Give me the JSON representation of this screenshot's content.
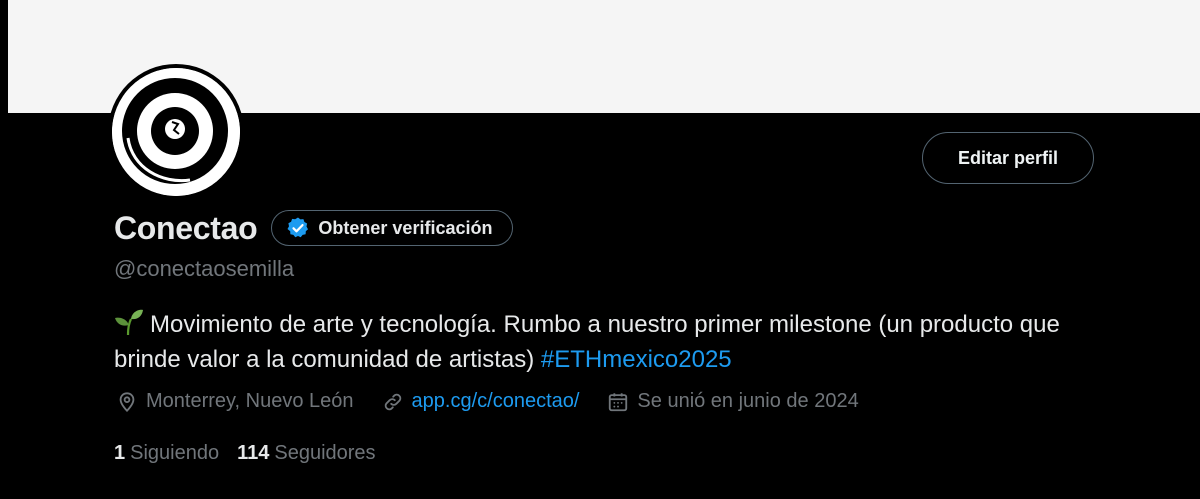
{
  "profile": {
    "name": "Conectao",
    "handle": "@conectaosemilla",
    "verify_label": "Obtener verificación",
    "edit_label": "Editar perfil",
    "bio": {
      "emoji_icon": "seedling-icon",
      "text": "Movimiento de arte y tecnología. Rumbo a nuestro primer milestone (un producto que brinde valor a la comunidad de artistas) ",
      "hashtag": "#ETHmexico2025"
    },
    "meta": {
      "location": "Monterrey, Nuevo León",
      "link": "app.cg/c/conectao/",
      "joined": "Se unió en junio de 2024"
    },
    "stats": {
      "following_count": "1",
      "following_label": "Siguiendo",
      "followers_count": "114",
      "followers_label": "Seguidores"
    }
  },
  "colors": {
    "background": "#000000",
    "banner": "#f5f5f5",
    "primary_text": "#e7e9ea",
    "secondary_text": "#71767b",
    "accent": "#1d9bf0",
    "border": "#536471"
  },
  "icons": {
    "location": "location-pin-icon",
    "link": "link-icon",
    "calendar": "calendar-icon",
    "verified": "verified-badge-icon"
  }
}
